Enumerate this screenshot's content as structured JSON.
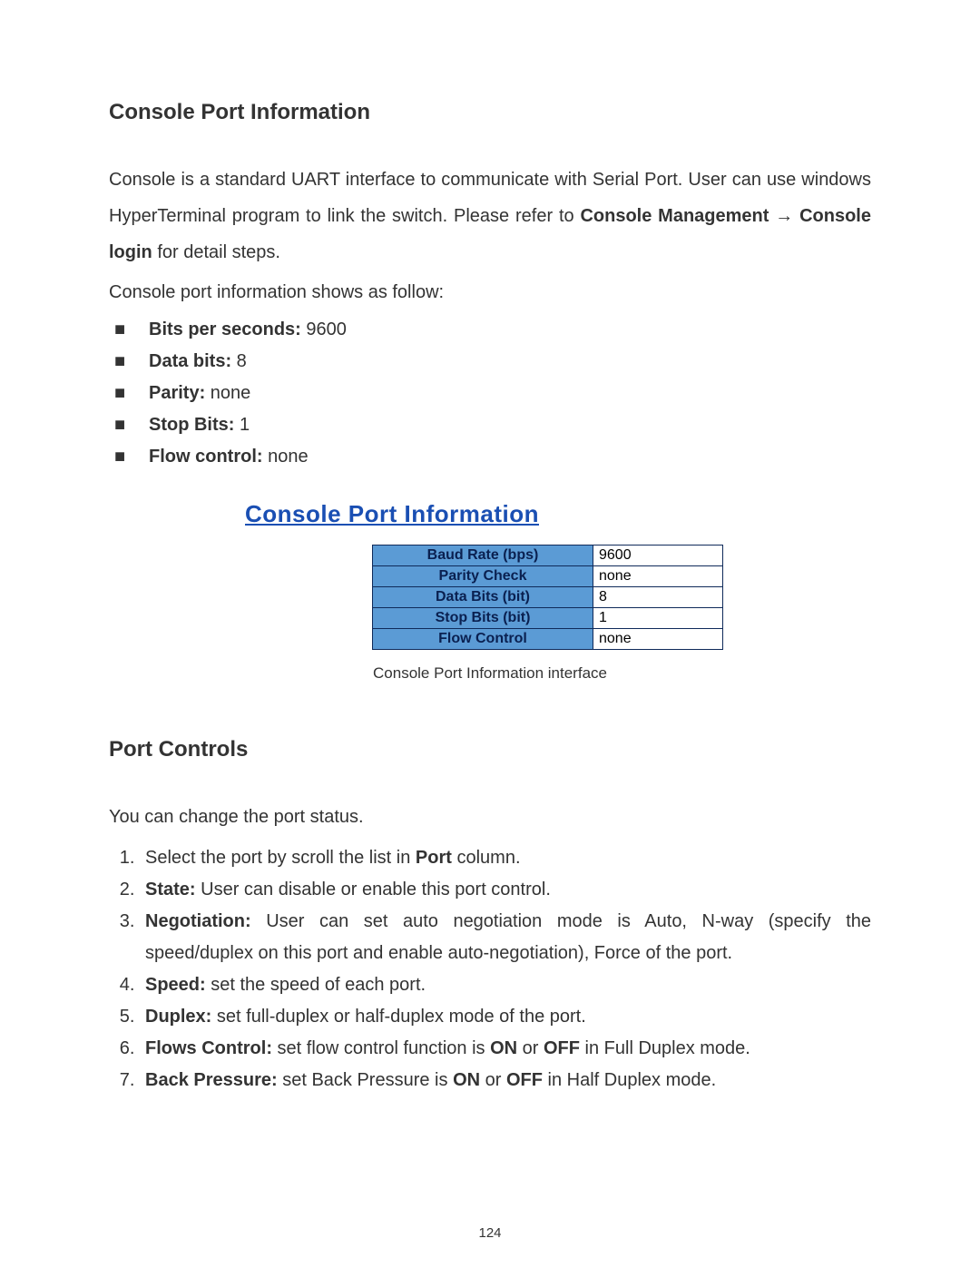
{
  "section1": {
    "heading": "Console Port Information",
    "para1_pre": "Console is a standard UART interface to communicate with Serial Port. User can use windows HyperTerminal program to link the switch. Please refer to ",
    "para1_bold": "Console Management → Console login",
    "para1_post": " for detail steps.",
    "para2": "Console port information shows as follow:",
    "bullets": [
      {
        "label": "Bits per seconds:",
        "value": " 9600"
      },
      {
        "label": "Data bits:",
        "value": " 8"
      },
      {
        "label": "Parity:",
        "value": " none"
      },
      {
        "label": "Stop Bits:",
        "value": " 1"
      },
      {
        "label": "Flow control:",
        "value": " none"
      }
    ]
  },
  "screenshot": {
    "title": "Console Port Information",
    "rows": [
      {
        "label": "Baud Rate (bps)",
        "value": "9600"
      },
      {
        "label": "Parity Check",
        "value": "none"
      },
      {
        "label": "Data Bits (bit)",
        "value": "8"
      },
      {
        "label": "Stop Bits (bit)",
        "value": "1"
      },
      {
        "label": "Flow Control",
        "value": "none"
      }
    ],
    "caption": "Console Port Information interface"
  },
  "section2": {
    "heading": "Port Controls",
    "intro": "You can change the port status.",
    "items": {
      "i1_pre": "Select the port by scroll the list in ",
      "i1_bold": "Port",
      "i1_post": " column.",
      "i2_bold": "State:",
      "i2_post": " User can disable or enable this port control.",
      "i3_bold": "Negotiation:",
      "i3_post": " User can set auto negotiation mode is Auto, N-way (specify the speed/duplex on this port and enable auto-negotiation), Force of the port.",
      "i4_bold": "Speed:",
      "i4_post": " set the speed of each port.",
      "i5_bold": "Duplex:",
      "i5_post": " set full-duplex or half-duplex mode of the port.",
      "i6_bold": "Flows Control:",
      "i6_mid": " set flow control function is ",
      "i6_b1": "ON",
      "i6_or": " or ",
      "i6_b2": "OFF",
      "i6_post": " in Full Duplex mode.",
      "i7_bold": "Back Pressure:",
      "i7_mid": " set Back Pressure is ",
      "i7_b1": "ON",
      "i7_or": " or ",
      "i7_b2": "OFF",
      "i7_post": " in Half Duplex mode."
    }
  },
  "page_number": "124"
}
